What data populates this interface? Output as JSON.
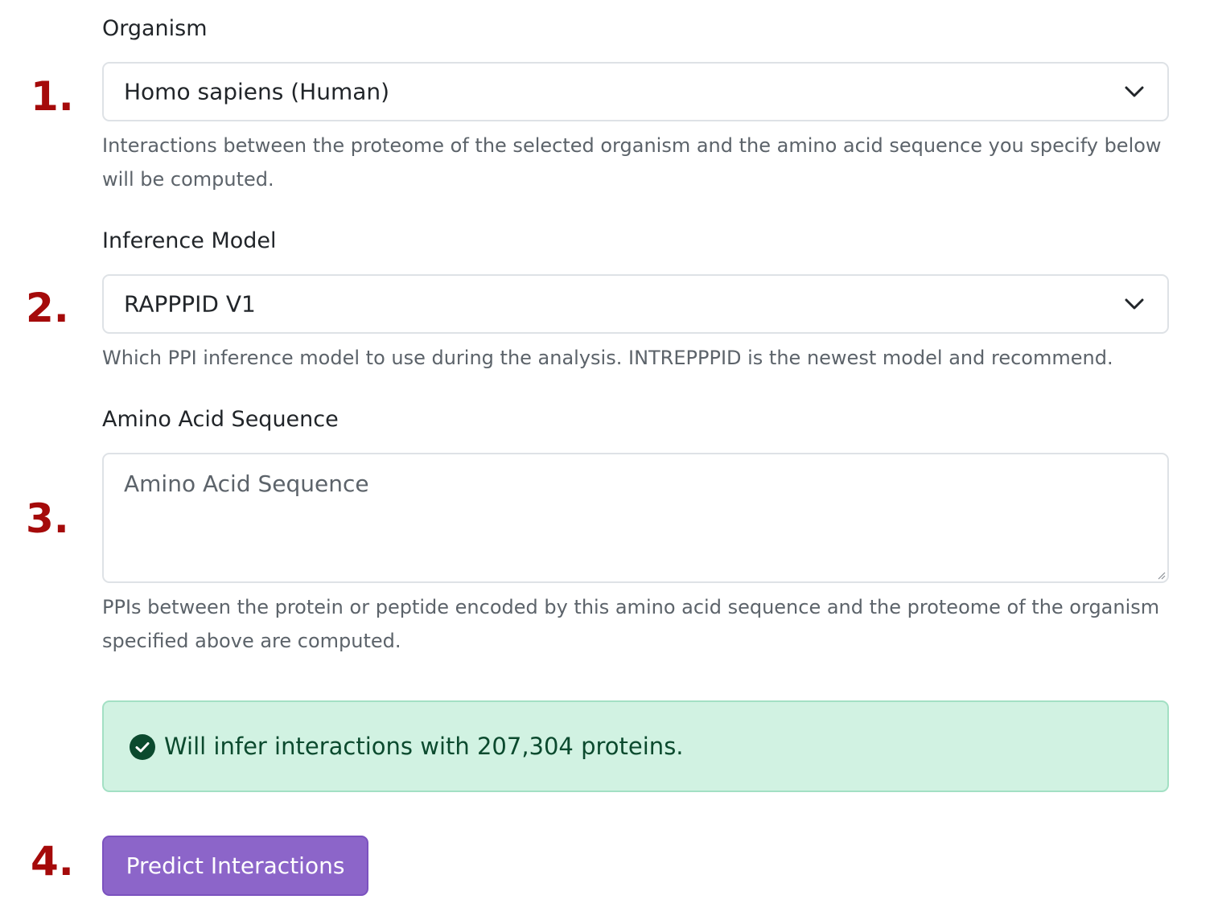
{
  "steps": [
    "1.",
    "2.",
    "3.",
    "4."
  ],
  "organism": {
    "label": "Organism",
    "selected": "Homo sapiens (Human)",
    "help": "Interactions between the proteome of the selected organism and the amino acid sequence you specify below will be computed."
  },
  "model": {
    "label": "Inference Model",
    "selected": "RAPPPID V1",
    "help": "Which PPI inference model to use during the analysis. INTREPPPID is the newest model and recommend."
  },
  "sequence": {
    "label": "Amino Acid Sequence",
    "placeholder": "Amino Acid Sequence",
    "help": "PPIs between the protein or peptide encoded by this amino acid sequence and the proteome of the organism specified above are computed."
  },
  "alert": {
    "text": "Will infer interactions with 207,304 proteins.",
    "icon": "check-circle-icon",
    "color": "#d1f2e2"
  },
  "submit": {
    "label": "Predict Interactions",
    "color": "#8c65c9"
  },
  "colors": {
    "step_number": "#a50a0a"
  }
}
